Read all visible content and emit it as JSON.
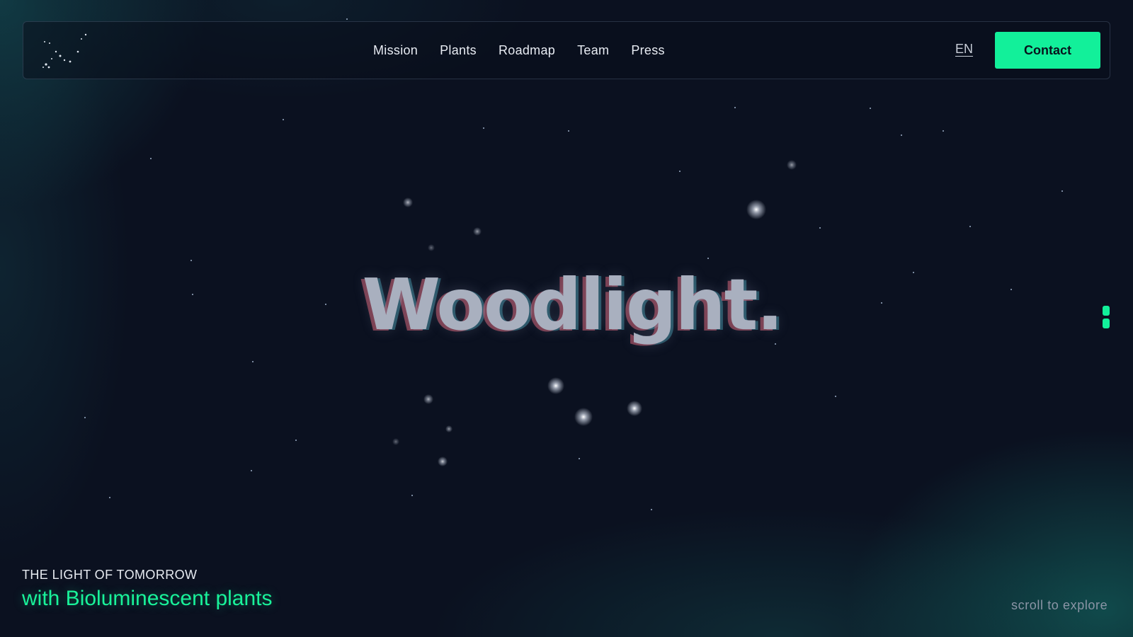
{
  "header": {
    "logo_icon": "constellation-logo-icon",
    "nav_items": [
      {
        "label": "Mission"
      },
      {
        "label": "Plants"
      },
      {
        "label": "Roadmap"
      },
      {
        "label": "Team"
      },
      {
        "label": "Press"
      }
    ],
    "language": "EN",
    "contact_label": "Contact"
  },
  "hero": {
    "title": "Woodlight."
  },
  "tagline": {
    "top": "THE LIGHT OF TOMORROW",
    "bottom": "with Bioluminescent plants"
  },
  "scroll_hint": "scroll to explore",
  "colors": {
    "background": "#0b1120",
    "accent": "#12f09a",
    "text": "#e8ecf3",
    "muted_text": "#8b95a6"
  }
}
